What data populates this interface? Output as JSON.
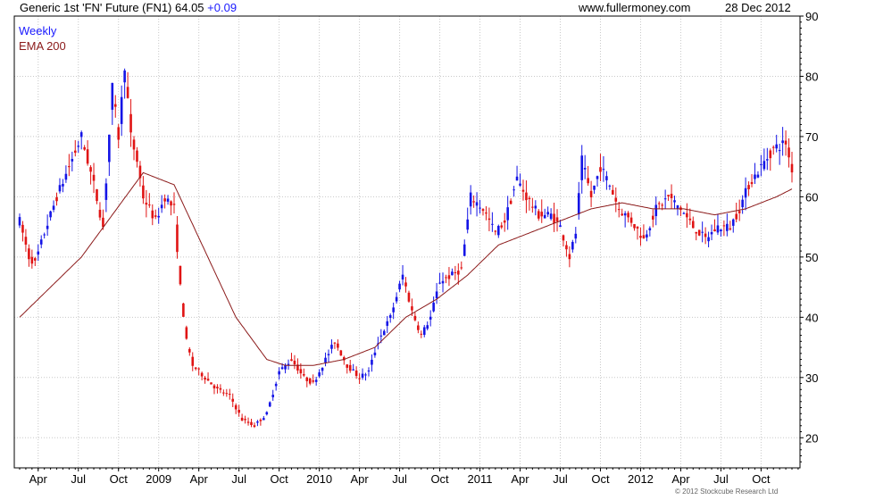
{
  "header": {
    "title": "Generic 1st 'FN' Future (FN1) 64.05",
    "change": "+0.09",
    "website": "www.fullermoney.com",
    "date": "28 Dec 2012"
  },
  "legend": {
    "period": "Weekly",
    "ema": "EMA 200"
  },
  "footer": {
    "copyright": "© 2012 Stockcube Research Ltd"
  },
  "colors": {
    "up": "#1414e6",
    "down": "#e01414",
    "ema": "#8b1a1a",
    "grid": "#c8c8c8",
    "period_label": "#1a1aff"
  },
  "chart_data": {
    "type": "candlestick",
    "title": "Generic 1st 'FN' Future (FN1) 64.05",
    "frequency": "Weekly",
    "xlabel": "",
    "ylabel": "",
    "ylim": [
      15,
      90
    ],
    "y_ticks": [
      20,
      30,
      40,
      50,
      60,
      70,
      80,
      90
    ],
    "y_axis_side": "right",
    "grid": true,
    "legend": "top-left",
    "x_tick_labels": [
      {
        "label": "Apr",
        "week": 6
      },
      {
        "label": "Jul",
        "week": 19
      },
      {
        "label": "Oct",
        "week": 32
      },
      {
        "label": "2009",
        "week": 45
      },
      {
        "label": "Apr",
        "week": 58
      },
      {
        "label": "Jul",
        "week": 71
      },
      {
        "label": "Oct",
        "week": 84
      },
      {
        "label": "2010",
        "week": 97
      },
      {
        "label": "Apr",
        "week": 110
      },
      {
        "label": "Jul",
        "week": 123
      },
      {
        "label": "Oct",
        "week": 136
      },
      {
        "label": "2011",
        "week": 149
      },
      {
        "label": "Apr",
        "week": 162
      },
      {
        "label": "Jul",
        "week": 175
      },
      {
        "label": "Oct",
        "week": 188
      },
      {
        "label": "2012",
        "week": 201
      },
      {
        "label": "Apr",
        "week": 214
      },
      {
        "label": "Jul",
        "week": 227
      },
      {
        "label": "Oct",
        "week": 240
      }
    ],
    "price_keypoints": [
      [
        0,
        56
      ],
      [
        3,
        50
      ],
      [
        5,
        49
      ],
      [
        8,
        54
      ],
      [
        12,
        60
      ],
      [
        16,
        65
      ],
      [
        20,
        70
      ],
      [
        24,
        62
      ],
      [
        27,
        55
      ],
      [
        30,
        78
      ],
      [
        32,
        70
      ],
      [
        34,
        82
      ],
      [
        36,
        70
      ],
      [
        38,
        66
      ],
      [
        40,
        60
      ],
      [
        44,
        56
      ],
      [
        47,
        60
      ],
      [
        50,
        58
      ],
      [
        52,
        45
      ],
      [
        54,
        36
      ],
      [
        56,
        32
      ],
      [
        60,
        30
      ],
      [
        64,
        28
      ],
      [
        68,
        27
      ],
      [
        72,
        23
      ],
      [
        76,
        22
      ],
      [
        80,
        24
      ],
      [
        84,
        31
      ],
      [
        88,
        33
      ],
      [
        92,
        30
      ],
      [
        95,
        29
      ],
      [
        98,
        32
      ],
      [
        102,
        36
      ],
      [
        106,
        32
      ],
      [
        110,
        30
      ],
      [
        113,
        31
      ],
      [
        116,
        36
      ],
      [
        120,
        40
      ],
      [
        124,
        47
      ],
      [
        127,
        41
      ],
      [
        130,
        37
      ],
      [
        133,
        40
      ],
      [
        136,
        46
      ],
      [
        140,
        47
      ],
      [
        143,
        48
      ],
      [
        146,
        60
      ],
      [
        150,
        58
      ],
      [
        154,
        54
      ],
      [
        157,
        56
      ],
      [
        161,
        63
      ],
      [
        164,
        60
      ],
      [
        168,
        57
      ],
      [
        172,
        57
      ],
      [
        175,
        55
      ],
      [
        178,
        50
      ],
      [
        180,
        54
      ],
      [
        182,
        66
      ],
      [
        185,
        60
      ],
      [
        188,
        65
      ],
      [
        191,
        62
      ],
      [
        194,
        58
      ],
      [
        198,
        56
      ],
      [
        202,
        53
      ],
      [
        206,
        58
      ],
      [
        210,
        60
      ],
      [
        214,
        58
      ],
      [
        218,
        55
      ],
      [
        222,
        53
      ],
      [
        226,
        55
      ],
      [
        230,
        55
      ],
      [
        233,
        58
      ],
      [
        236,
        62
      ],
      [
        240,
        65
      ],
      [
        244,
        68
      ],
      [
        248,
        69
      ],
      [
        250,
        64.05
      ]
    ],
    "ema_200": [
      [
        0,
        40
      ],
      [
        20,
        50
      ],
      [
        40,
        64
      ],
      [
        50,
        62
      ],
      [
        60,
        51
      ],
      [
        70,
        40
      ],
      [
        80,
        33
      ],
      [
        86,
        32
      ],
      [
        95,
        32
      ],
      [
        105,
        33
      ],
      [
        115,
        35
      ],
      [
        125,
        40
      ],
      [
        135,
        43
      ],
      [
        145,
        47
      ],
      [
        155,
        52
      ],
      [
        165,
        54
      ],
      [
        175,
        56
      ],
      [
        185,
        58
      ],
      [
        195,
        59
      ],
      [
        205,
        58
      ],
      [
        215,
        58
      ],
      [
        225,
        57
      ],
      [
        235,
        58
      ],
      [
        245,
        60
      ],
      [
        250,
        61.3
      ]
    ],
    "last_close": 64.05,
    "change": 0.09
  }
}
